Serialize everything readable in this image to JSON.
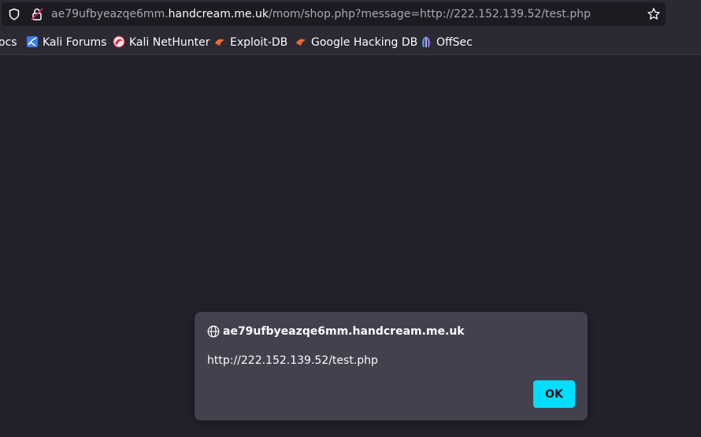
{
  "browser": {
    "url_prefix": "ae79ufbyeazqe6mm.",
    "url_host": "handcream.me.uk",
    "url_path": "/mom/shop.php?message=http://222.152.139.52/test.php",
    "bookmarks": [
      {
        "label": "ocs",
        "icon": "docs-icon"
      },
      {
        "label": "Kali Forums",
        "icon": "kali-forums-icon"
      },
      {
        "label": "Kali NetHunter",
        "icon": "kali-nethunter-icon"
      },
      {
        "label": "Exploit-DB",
        "icon": "exploit-db-icon"
      },
      {
        "label": "Google Hacking DB",
        "icon": "google-hacking-db-icon"
      },
      {
        "label": "OffSec",
        "icon": "offsec-icon"
      }
    ]
  },
  "dialog": {
    "origin": "ae79ufbyeazqe6mm.handcream.me.uk",
    "message": "http://222.152.139.52/test.php",
    "ok_label": "OK"
  },
  "colors": {
    "page_bg": "#23222b",
    "toolbar_bg": "#2b2a33",
    "dialog_bg": "#42414d",
    "accent_button": "#00ddff"
  }
}
